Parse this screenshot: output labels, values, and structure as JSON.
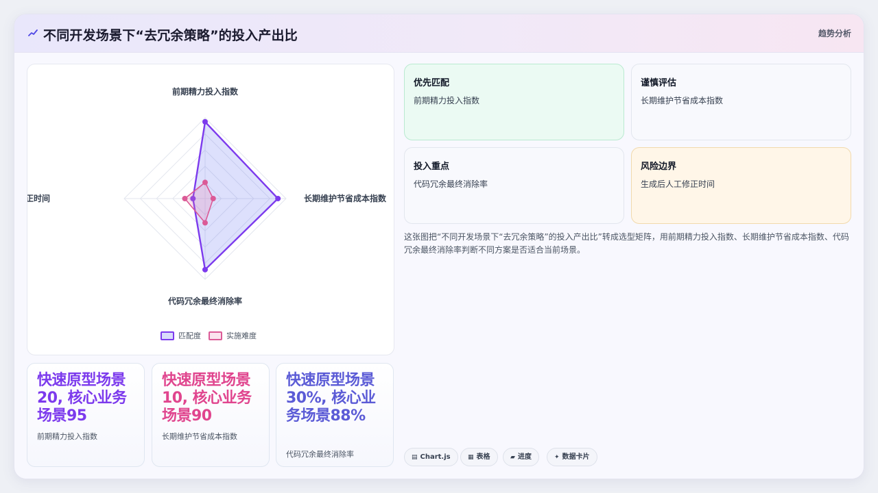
{
  "header": {
    "title": "不同开发场景下“去冗余策略”的投入产出比",
    "action": "趋势分析"
  },
  "chart_data": {
    "type": "radar",
    "axes": [
      "前期精力投入指数",
      "长期维护节省成本指数",
      "代码冗余最终消除率",
      "生成后人工修正时间"
    ],
    "series": [
      {
        "name": "匹配度",
        "color": "#7c3aed",
        "values": [
          95,
          90,
          88,
          15
        ]
      },
      {
        "name": "实施难度",
        "color": "#db5a96",
        "values": [
          20,
          10,
          30,
          25
        ]
      }
    ],
    "rlim": [
      0,
      100
    ],
    "grid": true,
    "legend": "bottom"
  },
  "stats": [
    {
      "value": "快速原型场景20, 核心业务场景95",
      "caption": "前期精力投入指数",
      "color": "#7c3aed"
    },
    {
      "value": "快速原型场景10, 核心业务场景90",
      "caption": "长期维护节省成本指数",
      "color": "#e0458e"
    },
    {
      "value": "快速原型场景30%, 核心业务场景88%",
      "caption": "代码冗余最终消除率",
      "color": "#5b5bd6"
    }
  ],
  "tiles": [
    {
      "title": "优先匹配",
      "desc": "前期精力投入指数",
      "bg": "#ebfaf3",
      "border": "#b9ead0"
    },
    {
      "title": "谨慎评估",
      "desc": "长期维护节省成本指数",
      "bg": "#f8f9fd",
      "border": "#e2e6ee"
    },
    {
      "title": "投入重点",
      "desc": "代码冗余最终消除率",
      "bg": "#f8f9fd",
      "border": "#e2e6ee"
    },
    {
      "title": "风险边界",
      "desc": "生成后人工修正时间",
      "bg": "#fff6e8",
      "border": "#f1d9ac"
    }
  ],
  "description": "这张图把“不同开发场景下“去冗余策略”的投入产出比”转成选型矩阵，用前期精力投入指数、长期维护节省成本指数、代码冗余最终消除率判断不同方案是否适合当前场景。",
  "chips": [
    {
      "icon": "▤",
      "label": "Chart.js"
    },
    {
      "icon": "▦",
      "label": "表格"
    },
    {
      "icon": "▰",
      "label": "进度"
    },
    {
      "icon": "✦",
      "label": "数据卡片"
    }
  ]
}
